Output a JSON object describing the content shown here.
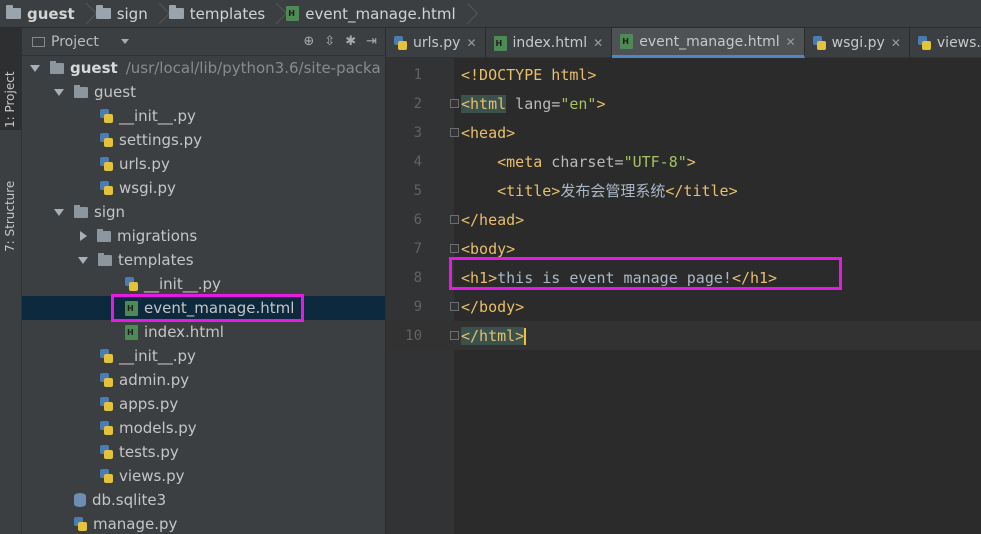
{
  "breadcrumb": {
    "items": [
      "guest",
      "sign",
      "templates",
      "event_manage.html"
    ]
  },
  "toolstrip": {
    "project_tab": "1: Project",
    "structure_tab": "7: Structure"
  },
  "project_panel": {
    "title": "Project",
    "root": {
      "name": "guest",
      "path": "/usr/local/lib/python3.6/site-packa"
    },
    "guest_folder": {
      "name": "guest",
      "files": [
        "__init__.py",
        "settings.py",
        "urls.py",
        "wsgi.py"
      ]
    },
    "sign_folder": {
      "name": "sign"
    },
    "migrations": "migrations",
    "templates": "templates",
    "template_files": [
      "__init__.py",
      "event_manage.html",
      "index.html"
    ],
    "sign_files": [
      "__init__.py",
      "admin.py",
      "apps.py",
      "models.py",
      "tests.py",
      "views.py"
    ],
    "root_files": [
      "db.sqlite3",
      "manage.py"
    ]
  },
  "tabs": [
    "urls.py",
    "index.html",
    "event_manage.html",
    "wsgi.py",
    "views.py"
  ],
  "editor": {
    "line_numbers": [
      "1",
      "2",
      "3",
      "4",
      "5",
      "6",
      "7",
      "8",
      "9",
      "10"
    ],
    "l1": "<!DOCTYPE html>",
    "l2_open": "<html",
    "l2_attr": " lang=",
    "l2_val": "\"en\"",
    "l2_close": ">",
    "l3": "<head>",
    "l4_open": "<meta",
    "l4_attr": " charset=",
    "l4_val": "\"UTF-8\"",
    "l4_close": ">",
    "l5_open": "<title>",
    "l5_text": "发布会管理系统",
    "l5_close": "</title>",
    "l6": "</head>",
    "l7": "<body>",
    "l8_open": "<h1>",
    "l8_text": "this is event manage page!",
    "l8_close": "</h1>",
    "l9": "</body>",
    "l10": "</html>"
  },
  "colors": {
    "highlight_box": "#e51be5",
    "tag": "#e8bf6a",
    "string": "#a5c261"
  }
}
